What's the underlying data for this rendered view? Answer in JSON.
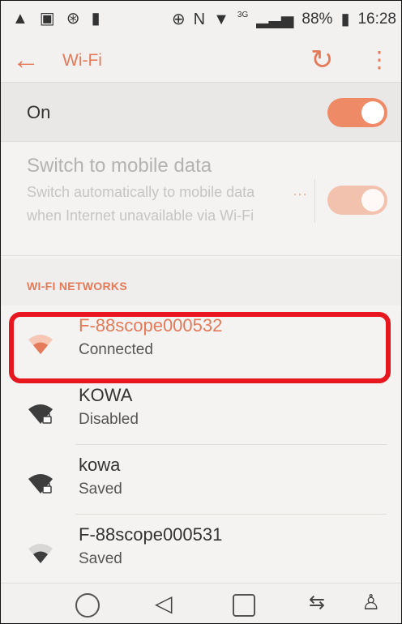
{
  "statusbar": {
    "left_icons": [
      "warning-icon",
      "image-icon",
      "clock-icon",
      "battery-saver-icon"
    ],
    "battery": "88%",
    "time": "16:28",
    "signal": "3G"
  },
  "appbar": {
    "title": "Wi-Fi"
  },
  "wifi_toggle": {
    "label": "On",
    "state": "on"
  },
  "mobile_data": {
    "title": "Switch to mobile data",
    "subtitle": "Switch automatically to mobile data when Internet unavailable via Wi-Fi",
    "dots": "···"
  },
  "section": {
    "title": "WI-FI NETWORKS"
  },
  "networks": [
    {
      "name": "F-88scope000532",
      "status": "Connected",
      "secured": false,
      "active": true
    },
    {
      "name": "KOWA",
      "status": "Disabled",
      "secured": true,
      "active": false
    },
    {
      "name": "kowa",
      "status": "Saved",
      "secured": true,
      "active": false
    },
    {
      "name": "F-88scope000531",
      "status": "Saved",
      "secured": false,
      "active": false
    }
  ],
  "colors": {
    "accent": "#e57a5a",
    "highlight": "#e6171f"
  }
}
